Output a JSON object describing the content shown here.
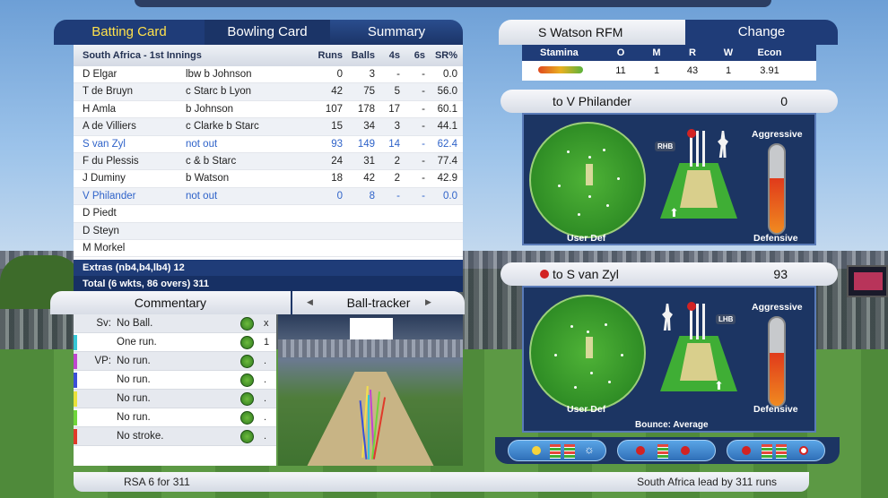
{
  "batting": {
    "tabs": [
      "Batting Card",
      "Bowling Card",
      "Summary"
    ],
    "innings_title": "South Africa - 1st Innings",
    "columns": {
      "runs": "Runs",
      "balls": "Balls",
      "fours": "4s",
      "sixes": "6s",
      "sr": "SR%"
    },
    "rows": [
      {
        "name": "D Elgar",
        "how": "lbw b Johnson",
        "runs": "0",
        "balls": "3",
        "fours": "-",
        "sixes": "-",
        "sr": "0.0"
      },
      {
        "name": "T de Bruyn",
        "how": "c Starc b Lyon",
        "runs": "42",
        "balls": "75",
        "fours": "5",
        "sixes": "-",
        "sr": "56.0"
      },
      {
        "name": "H Amla",
        "how": "b Johnson",
        "runs": "107",
        "balls": "178",
        "fours": "17",
        "sixes": "-",
        "sr": "60.1"
      },
      {
        "name": "A de Villiers",
        "how": "c Clarke b Starc",
        "runs": "15",
        "balls": "34",
        "fours": "3",
        "sixes": "-",
        "sr": "44.1"
      },
      {
        "name": "S van Zyl",
        "how": "not out",
        "runs": "93",
        "balls": "149",
        "fours": "14",
        "sixes": "-",
        "sr": "62.4"
      },
      {
        "name": "F du Plessis",
        "how": "c & b Starc",
        "runs": "24",
        "balls": "31",
        "fours": "2",
        "sixes": "-",
        "sr": "77.4"
      },
      {
        "name": "J Duminy",
        "how": "b Watson",
        "runs": "18",
        "balls": "42",
        "fours": "2",
        "sixes": "-",
        "sr": "42.9"
      },
      {
        "name": "V Philander",
        "how": "not out",
        "runs": "0",
        "balls": "8",
        "fours": "-",
        "sixes": "-",
        "sr": "0.0"
      },
      {
        "name": "D Piedt",
        "how": "",
        "runs": "",
        "balls": "",
        "fours": "",
        "sixes": "",
        "sr": ""
      },
      {
        "name": "D Steyn",
        "how": "",
        "runs": "",
        "balls": "",
        "fours": "",
        "sixes": "",
        "sr": ""
      },
      {
        "name": "M Morkel",
        "how": "",
        "runs": "",
        "balls": "",
        "fours": "",
        "sixes": "",
        "sr": ""
      }
    ],
    "extras": "Extras (nb4,b4,lb4) 12",
    "total": "Total (6 wkts, 86 overs) 311"
  },
  "bowler": {
    "name": "S Watson RFM",
    "change_label": "Change",
    "columns": {
      "stamina": "Stamina",
      "o": "O",
      "m": "M",
      "r": "R",
      "w": "W",
      "econ": "Econ"
    },
    "stats": {
      "o": "11",
      "m": "1",
      "r": "43",
      "w": "1",
      "econ": "3.91"
    },
    "stamina_level": 0.7
  },
  "batter1": {
    "label": "to V Philander",
    "score": "0",
    "hand": "RHB",
    "aggressive": "Aggressive",
    "defensive": "Defensive",
    "field": "User Def",
    "aggression_level": 0.62
  },
  "batter2": {
    "label": "to S van Zyl",
    "score": "93",
    "hand": "LHB",
    "aggressive": "Aggressive",
    "defensive": "Defensive",
    "field": "User Def",
    "bounce": "Bounce: Average",
    "aggression_level": 0.6
  },
  "commentary": {
    "tab_label": "Commentary",
    "tracker_label": "Ball-tracker",
    "rows": [
      {
        "who": "Sv:",
        "text": "No Ball.",
        "val": "x",
        "mark": ""
      },
      {
        "who": "",
        "text": "One run.",
        "val": "1",
        "mark": "#36c7d6"
      },
      {
        "who": "VP:",
        "text": "No run.",
        "val": ".",
        "mark": "#c045d0"
      },
      {
        "who": "",
        "text": "No run.",
        "val": ".",
        "mark": "#3b4fd8"
      },
      {
        "who": "",
        "text": "No run.",
        "val": ".",
        "mark": "#e8e13a"
      },
      {
        "who": "",
        "text": "No run.",
        "val": ".",
        "mark": "#6fd63a"
      },
      {
        "who": "",
        "text": "No stroke.",
        "val": ".",
        "mark": "#e03a2a"
      }
    ]
  },
  "status": {
    "left": "RSA  6 for 311",
    "right": "South Africa lead by 311 runs"
  },
  "colors": {
    "accent": "#1f3c78",
    "active_tab": "#ffe14b",
    "not_out": "#2f63c9"
  }
}
